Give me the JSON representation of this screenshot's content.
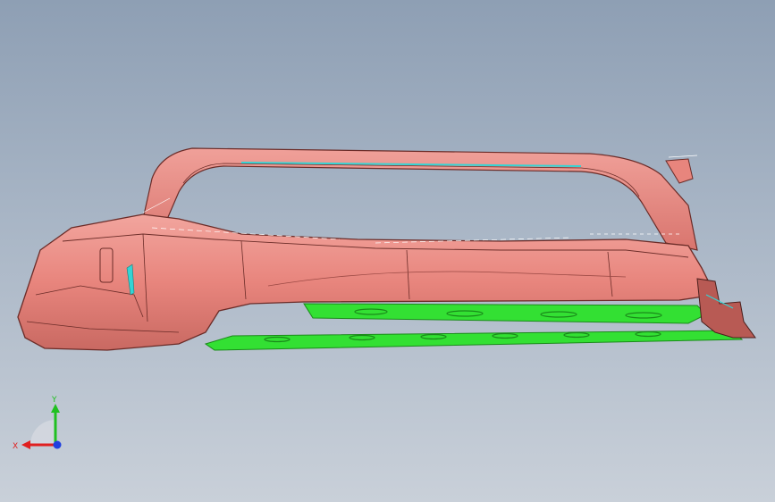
{
  "viewport": {
    "background_top": "#8e9fb4",
    "background_bottom": "#c9d0d9"
  },
  "model": {
    "body_color": "#e8857d",
    "body_shade": "#c96962",
    "body_highlight": "#f5aaa3",
    "edge_color": "#6b2c28",
    "seal_color": "#33e033",
    "seal_dark": "#1a8a1a",
    "accent_color": "#34d4d4"
  },
  "triad": {
    "x_label": "X",
    "y_label": "Y",
    "x_color": "#e02020",
    "y_color": "#20c020",
    "z_color": "#2040e0",
    "icon": "coordinate-triad-icon"
  }
}
